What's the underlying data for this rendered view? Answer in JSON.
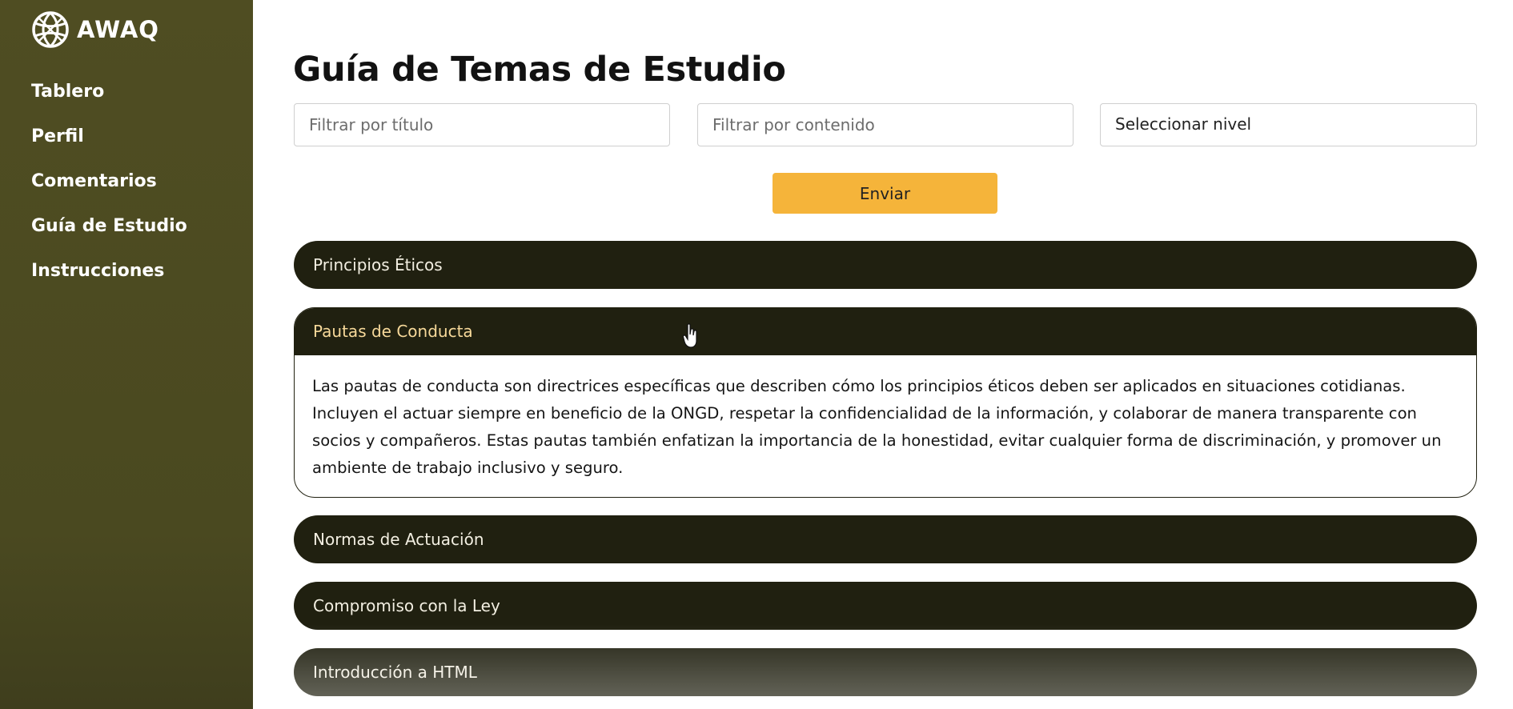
{
  "app": {
    "logo_text": "AWAQ",
    "logo_icon": "globe-logo-icon"
  },
  "sidebar": {
    "items": [
      {
        "label": "Tablero"
      },
      {
        "label": "Perfil"
      },
      {
        "label": "Comentarios"
      },
      {
        "label": "Guía de Estudio"
      },
      {
        "label": "Instrucciones"
      }
    ]
  },
  "main": {
    "title": "Guía de Temas de Estudio",
    "filters": {
      "title_placeholder": "Filtrar por título",
      "content_placeholder": "Filtrar por contenido",
      "level_select": "Seleccionar nivel"
    },
    "submit_label": "Enviar",
    "topics": [
      {
        "title": "Principios Éticos",
        "expanded": false
      },
      {
        "title": "Pautas de Conducta",
        "expanded": true,
        "content": "Las pautas de conducta son directrices específicas que describen cómo los principios éticos deben ser aplicados en situaciones cotidianas. Incluyen el actuar siempre en beneficio de la ONGD, respetar la confidencialidad de la información, y colaborar de manera transparente con socios y compañeros. Estas pautas también enfatizan la importancia de la honestidad, evitar cualquier forma de discriminación, y promover un ambiente de trabajo inclusivo y seguro."
      },
      {
        "title": "Normas de Actuación",
        "expanded": false
      },
      {
        "title": "Compromiso con la Ley",
        "expanded": false
      },
      {
        "title": "Introducción a HTML",
        "expanded": false
      }
    ]
  },
  "colors": {
    "sidebar_bg": "#4f4d22",
    "accordion_bg": "#202010",
    "accent_button": "#f5b43a",
    "active_header_text": "#f7d99a"
  }
}
